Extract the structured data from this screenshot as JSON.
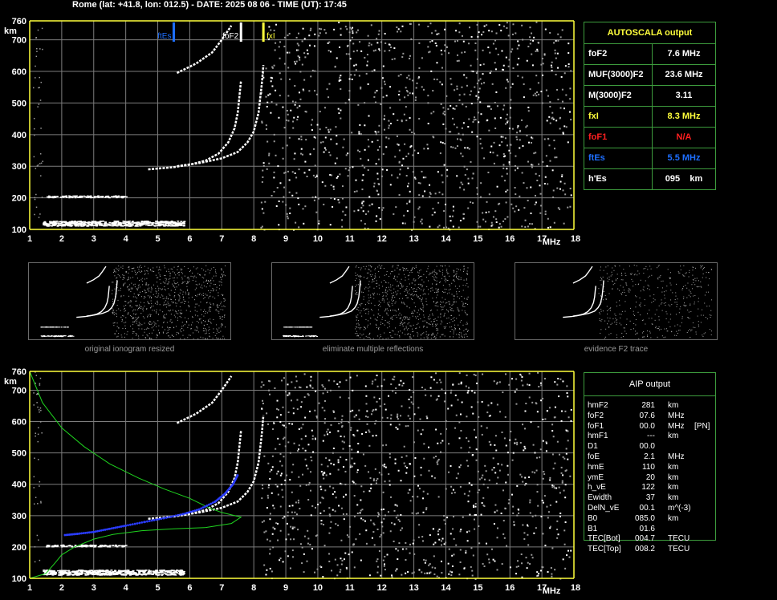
{
  "header": {
    "text": "Rome (lat: +41.8, lon: 012.5) - DATE: 2025 08 06 - TIME (UT): 17:45"
  },
  "colors": {
    "grid": "#7d7d7d",
    "axis": "#ffff3c",
    "fxI": "#ffff3c",
    "ftEs": "#1e6fff",
    "foF1": "#ff2020",
    "table_border": "#3d9c3d",
    "profile_green": "#1fd41f",
    "profile_blue": "#2a3cff"
  },
  "chart_data": [
    {
      "type": "scatter",
      "name_ref": "top-ionogram",
      "xlim": [
        1,
        18
      ],
      "ylim": [
        100,
        760
      ],
      "xlabel": "MHz",
      "ylabel": "km",
      "x_ticks": [
        "1",
        "2",
        "3",
        "4",
        "5",
        "6",
        "7",
        "8",
        "9",
        "10",
        "11",
        "12",
        "13",
        "14",
        "15",
        "16",
        "17",
        "18"
      ],
      "y_ticks": [
        "100",
        "200",
        "300",
        "400",
        "500",
        "600",
        "700",
        "760"
      ],
      "annotations": [
        {
          "label": "ftEs",
          "x": 5.5,
          "color": "#1e6fff"
        },
        {
          "label": "foF2",
          "x": 7.6,
          "color": "#ffffff"
        },
        {
          "label": "fxI",
          "x": 8.3,
          "color": "#ffff3c"
        }
      ],
      "traces": {
        "Es_layer": {
          "x": [
            1.4,
            5.8
          ],
          "y": [
            120,
            120
          ]
        },
        "Es_second": {
          "x": [
            1.5,
            4.0
          ],
          "y": [
            205,
            205
          ]
        },
        "F2_o": [
          [
            4.7,
            290
          ],
          [
            5.5,
            297
          ],
          [
            6.0,
            305
          ],
          [
            6.5,
            318
          ],
          [
            6.9,
            340
          ],
          [
            7.2,
            375
          ],
          [
            7.4,
            420
          ],
          [
            7.5,
            470
          ],
          [
            7.55,
            520
          ],
          [
            7.6,
            570
          ]
        ],
        "F2_x": [
          [
            5.6,
            300
          ],
          [
            6.3,
            310
          ],
          [
            7.0,
            325
          ],
          [
            7.5,
            345
          ],
          [
            7.8,
            375
          ],
          [
            8.0,
            410
          ],
          [
            8.15,
            470
          ],
          [
            8.25,
            560
          ],
          [
            8.3,
            620
          ]
        ],
        "F2_multi": [
          [
            5.6,
            595
          ],
          [
            6.2,
            625
          ],
          [
            6.7,
            660
          ],
          [
            7.0,
            700
          ],
          [
            7.3,
            745
          ]
        ]
      }
    },
    {
      "type": "scatter",
      "name_ref": "bottom-ionogram",
      "xlim": [
        1,
        18
      ],
      "ylim": [
        100,
        760
      ],
      "xlabel": "MHz",
      "ylabel": "km",
      "x_ticks": [
        "1",
        "2",
        "3",
        "4",
        "5",
        "6",
        "7",
        "8",
        "9",
        "10",
        "11",
        "12",
        "13",
        "14",
        "15",
        "16",
        "17",
        "18"
      ],
      "y_ticks": [
        "100",
        "200",
        "300",
        "400",
        "500",
        "600",
        "700",
        "760"
      ],
      "series": [
        {
          "color": "#1fd41f",
          "points": [
            [
              1.0,
              760
            ],
            [
              1.4,
              660
            ],
            [
              2.0,
              580
            ],
            [
              2.7,
              520
            ],
            [
              3.5,
              465
            ],
            [
              4.4,
              420
            ],
            [
              5.2,
              385
            ],
            [
              6.0,
              355
            ],
            [
              6.6,
              325
            ],
            [
              7.0,
              310
            ],
            [
              7.6,
              295
            ],
            [
              7.3,
              275
            ],
            [
              6.5,
              262
            ],
            [
              5.5,
              258
            ],
            [
              4.5,
              252
            ],
            [
              3.6,
              240
            ],
            [
              3.0,
              225
            ],
            [
              2.4,
              200
            ],
            [
              2.0,
              175
            ],
            [
              1.8,
              150
            ],
            [
              1.5,
              115
            ],
            [
              1.0,
              100
            ]
          ]
        },
        {
          "color": "#2a3cff",
          "points": [
            [
              2.1,
              238
            ],
            [
              2.5,
              242
            ],
            [
              3.0,
              248
            ],
            [
              3.5,
              258
            ],
            [
              4.0,
              268
            ],
            [
              4.6,
              280
            ],
            [
              5.2,
              292
            ],
            [
              5.8,
              305
            ],
            [
              6.3,
              320
            ],
            [
              6.8,
              345
            ],
            [
              7.1,
              370
            ],
            [
              7.35,
              400
            ],
            [
              7.5,
              430
            ]
          ]
        }
      ]
    }
  ],
  "thumbnails": [
    {
      "caption": "original ionogram resized"
    },
    {
      "caption": "eliminate multiple reflections"
    },
    {
      "caption": "evidence F2 trace"
    }
  ],
  "autoscala": {
    "title": "AUTOSCALA output",
    "rows": [
      {
        "label": "foF2",
        "value": "7.6 MHz",
        "color": "#ffffff"
      },
      {
        "label": "MUF(3000)F2",
        "value": "23.6 MHz",
        "color": "#ffffff"
      },
      {
        "label": "M(3000)F2",
        "value": "3.11",
        "color": "#ffffff"
      },
      {
        "label": "fxI",
        "value": "8.3 MHz",
        "color": "#ffff3c"
      },
      {
        "label": "foF1",
        "value": "N/A",
        "color": "#ff2020"
      },
      {
        "label": "ftEs",
        "value": "5.5 MHz",
        "color": "#1e6fff"
      },
      {
        "label": "h'Es",
        "value": "095    km",
        "color": "#ffffff"
      }
    ]
  },
  "aip": {
    "title": "AIP output",
    "rows": [
      {
        "name": "hmF2",
        "value": "281",
        "unit": "km",
        "flag": ""
      },
      {
        "name": "foF2",
        "value": "07.6",
        "unit": "MHz",
        "flag": ""
      },
      {
        "name": "foF1",
        "value": "00.0",
        "unit": "MHz",
        "flag": "[PN]"
      },
      {
        "name": "hmF1",
        "value": "---",
        "unit": "km",
        "flag": ""
      },
      {
        "name": "D1",
        "value": "00.0",
        "unit": "",
        "flag": ""
      },
      {
        "name": "foE",
        "value": "2.1",
        "unit": "MHz",
        "flag": ""
      },
      {
        "name": "hmE",
        "value": "110",
        "unit": "km",
        "flag": ""
      },
      {
        "name": "ymE",
        "value": "20",
        "unit": "km",
        "flag": ""
      },
      {
        "name": "h_vE",
        "value": "122",
        "unit": "km",
        "flag": ""
      },
      {
        "name": "Ewidth",
        "value": "37",
        "unit": "km",
        "flag": ""
      },
      {
        "name": "DelN_vE",
        "value": "00.1",
        "unit": "m^(-3)",
        "flag": ""
      },
      {
        "name": "B0",
        "value": "085.0",
        "unit": "km",
        "flag": ""
      },
      {
        "name": "B1",
        "value": "01.6",
        "unit": "",
        "flag": ""
      },
      {
        "name": "TEC[Bot]",
        "value": "004.7",
        "unit": "TECU",
        "flag": ""
      },
      {
        "name": "TEC[Top]",
        "value": "008.2",
        "unit": "TECU",
        "flag": ""
      }
    ]
  }
}
